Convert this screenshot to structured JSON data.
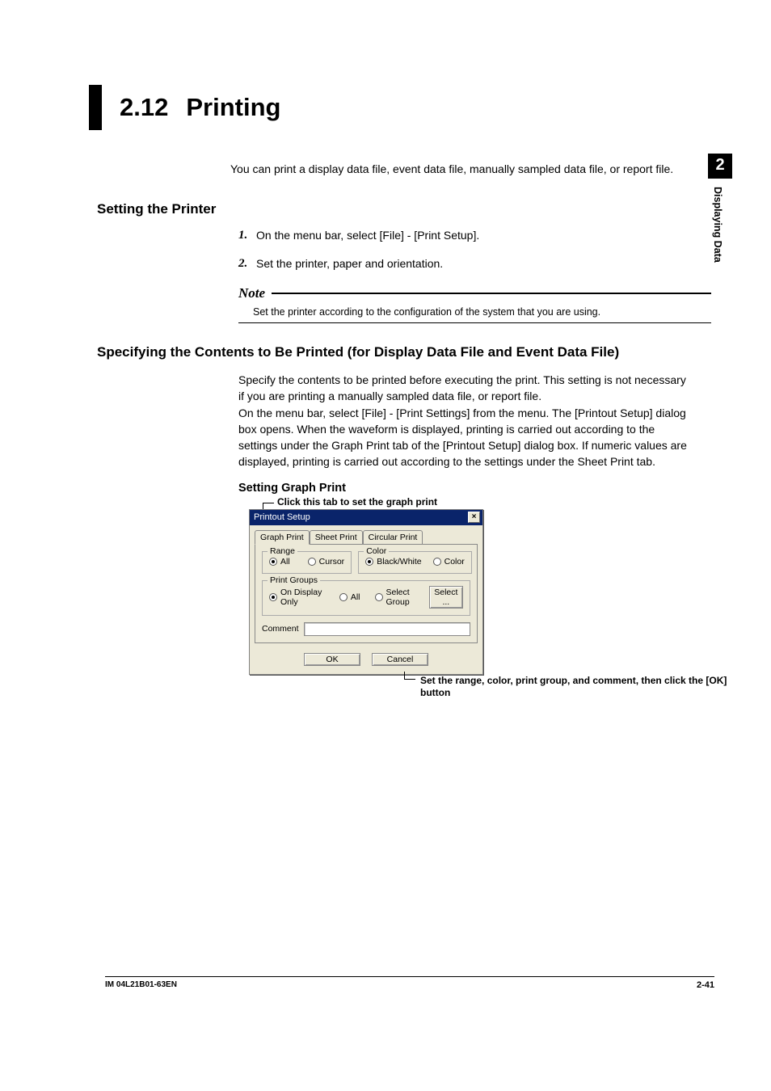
{
  "section": {
    "number": "2.12",
    "title": "Printing"
  },
  "intro": "You can print a display data file, event data file, manually sampled data file, or report file.",
  "settingPrinter": {
    "heading": "Setting the Printer",
    "steps": [
      {
        "n": "1.",
        "t": "On the menu bar, select [File] - [Print Setup]."
      },
      {
        "n": "2.",
        "t": "Set the printer, paper and orientation."
      }
    ],
    "noteLabel": "Note",
    "noteText": "Set the printer according to the configuration of the system that you are using."
  },
  "specifying": {
    "heading": "Specifying the Contents to Be Printed (for Display Data File and Event Data File)",
    "para": "Specify the contents to be printed before executing the print. This setting is not necessary if you are printing a manually sampled data file, or report file.\nOn the menu bar, select [File] - [Print Settings] from the menu. The [Printout Setup] dialog box opens. When the waveform is displayed, printing is carried out according to the settings under the Graph Print tab of the [Printout Setup] dialog box. If numeric values are displayed, printing is carried out according to the settings under the Sheet Print tab.",
    "subHeading": "Setting Graph Print",
    "calloutTop": "Click this tab to set the graph print",
    "calloutBottom": "Set the range, color, print group, and comment, then click the [OK] button"
  },
  "dialog": {
    "title": "Printout Setup",
    "close": "×",
    "tabs": {
      "graph": "Graph Print",
      "sheet": "Sheet Print",
      "circular": "Circular Print"
    },
    "range": {
      "legend": "Range",
      "all": "All",
      "cursor": "Cursor"
    },
    "color": {
      "legend": "Color",
      "bw": "Black/White",
      "color": "Color"
    },
    "printGroups": {
      "legend": "Print Groups",
      "onDisplay": "On Display Only",
      "all": "All",
      "selectGroup": "Select Group",
      "selectBtn": "Select ..."
    },
    "commentLabel": "Comment",
    "ok": "OK",
    "cancel": "Cancel"
  },
  "sideTab": {
    "num": "2",
    "text": "Displaying Data"
  },
  "footer": {
    "left": "IM 04L21B01-63EN",
    "right": "2-41"
  }
}
